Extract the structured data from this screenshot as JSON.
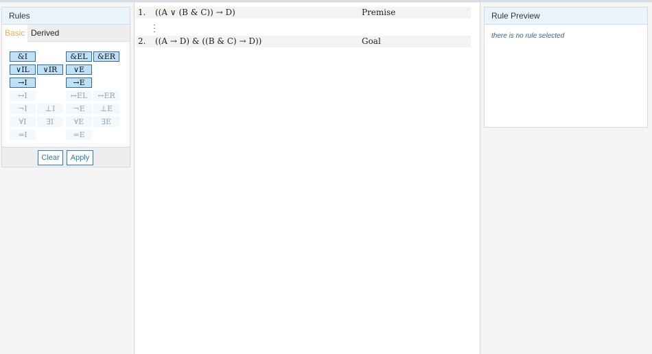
{
  "rules_panel": {
    "title": "Rules",
    "tabs": [
      {
        "label": "Basic",
        "active": true
      },
      {
        "label": "Derived",
        "active": false
      }
    ],
    "rules": [
      {
        "label": "&I",
        "enabled": true,
        "col": 0,
        "row": 0
      },
      {
        "label": "&EL",
        "enabled": true,
        "col": 2,
        "row": 0
      },
      {
        "label": "&ER",
        "enabled": true,
        "col": 3,
        "row": 0
      },
      {
        "label": "∨IL",
        "enabled": true,
        "col": 0,
        "row": 1
      },
      {
        "label": "∨IR",
        "enabled": true,
        "col": 1,
        "row": 1
      },
      {
        "label": "∨E",
        "enabled": true,
        "col": 2,
        "row": 1
      },
      {
        "label": "→I",
        "enabled": true,
        "col": 0,
        "row": 2
      },
      {
        "label": "→E",
        "enabled": true,
        "col": 2,
        "row": 2
      },
      {
        "label": "↔I",
        "enabled": false,
        "col": 0,
        "row": 3
      },
      {
        "label": "↔EL",
        "enabled": false,
        "col": 2,
        "row": 3
      },
      {
        "label": "↔ER",
        "enabled": false,
        "col": 3,
        "row": 3
      },
      {
        "label": "¬I",
        "enabled": false,
        "col": 0,
        "row": 4
      },
      {
        "label": "⊥I",
        "enabled": false,
        "col": 1,
        "row": 4
      },
      {
        "label": "¬E",
        "enabled": false,
        "col": 2,
        "row": 4
      },
      {
        "label": "⊥E",
        "enabled": false,
        "col": 3,
        "row": 4
      },
      {
        "label": "∀I",
        "enabled": false,
        "col": 0,
        "row": 5
      },
      {
        "label": "∃I",
        "enabled": false,
        "col": 1,
        "row": 5
      },
      {
        "label": "∀E",
        "enabled": false,
        "col": 2,
        "row": 5
      },
      {
        "label": "∃E",
        "enabled": false,
        "col": 3,
        "row": 5
      },
      {
        "label": "=I",
        "enabled": false,
        "col": 0,
        "row": 6
      },
      {
        "label": "=E",
        "enabled": false,
        "col": 2,
        "row": 6
      }
    ],
    "clear_label": "Clear",
    "apply_label": "Apply"
  },
  "proof": {
    "lines": [
      {
        "number": "1.",
        "formula": "((A ∨ (B & C)) → D)",
        "justification": "Premise"
      },
      {
        "number": "2.",
        "formula": "((A → D) & ((B & C) → D))",
        "justification": "Goal"
      }
    ],
    "gap_indicator": "⋮"
  },
  "preview_panel": {
    "title": "Rule Preview",
    "empty_message": "there is no rule selected"
  },
  "colors": {
    "active_tab": "#f0ad4e",
    "rule_enabled_bg": "#bfe0f5",
    "rule_enabled_border": "#2a6f9b",
    "button_accent": "#2b79b8",
    "panel_header_bg": "#eaf4fd"
  }
}
